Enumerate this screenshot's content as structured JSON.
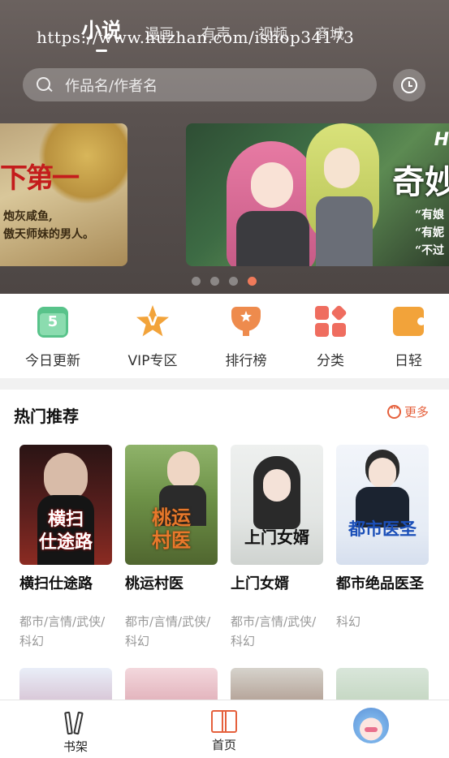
{
  "header": {
    "tabs": [
      {
        "label": "小说",
        "active": true
      },
      {
        "label": "漫画",
        "active": false
      },
      {
        "label": "有声",
        "active": false
      },
      {
        "label": "视频",
        "active": false
      },
      {
        "label": "商城",
        "active": false
      }
    ],
    "watermark": "https://www.huzhan.com/ishop34173",
    "search_placeholder": "作品名/作者名",
    "history_icon": "clock-icon"
  },
  "banners": [
    {
      "title": "下第一",
      "subtitle": "炮灰咸鱼,\n傲天师妹的男人。"
    },
    {
      "badge": "H",
      "title": "奇妙",
      "subtitle": "“有娘\n“有妮\n“不过"
    }
  ],
  "carousel": {
    "count": 4,
    "active_index": 3
  },
  "quick_menu": [
    {
      "label": "今日更新",
      "icon": "calendar-icon",
      "icon_text": "5",
      "color": "#58c38a"
    },
    {
      "label": "VIP专区",
      "icon": "vip-star-icon",
      "icon_text": "V",
      "color": "#f2a33a"
    },
    {
      "label": "排行榜",
      "icon": "ranking-badge-icon",
      "color": "#ee8b4d"
    },
    {
      "label": "分类",
      "icon": "category-grid-icon",
      "color": "#ef6d5f"
    },
    {
      "label": "日轻",
      "icon": "light-novel-icon",
      "color": "#f2a33a"
    }
  ],
  "hot": {
    "title": "热门推荐",
    "more_label": "更多",
    "accent": "#e5603c",
    "books": [
      {
        "name": "横扫仕途路",
        "tags": "都市/言情/武侠/科幻",
        "cover_text": "横扫\n仕途路"
      },
      {
        "name": "桃运村医",
        "tags": "都市/言情/武侠/科幻",
        "cover_text": "桃运\n村医"
      },
      {
        "name": "上门女婿",
        "tags": "都市/言情/武侠/科幻",
        "cover_text": "上门女婿"
      },
      {
        "name": "都市绝品医圣",
        "tags": "科幻",
        "cover_text": "都市医圣"
      }
    ]
  },
  "bottom_nav": [
    {
      "label": "书架",
      "icon": "bookshelf-icon",
      "active": false
    },
    {
      "label": "首页",
      "icon": "open-book-icon",
      "active": true
    },
    {
      "label": "",
      "icon": "avatar-icon",
      "active": false
    }
  ]
}
